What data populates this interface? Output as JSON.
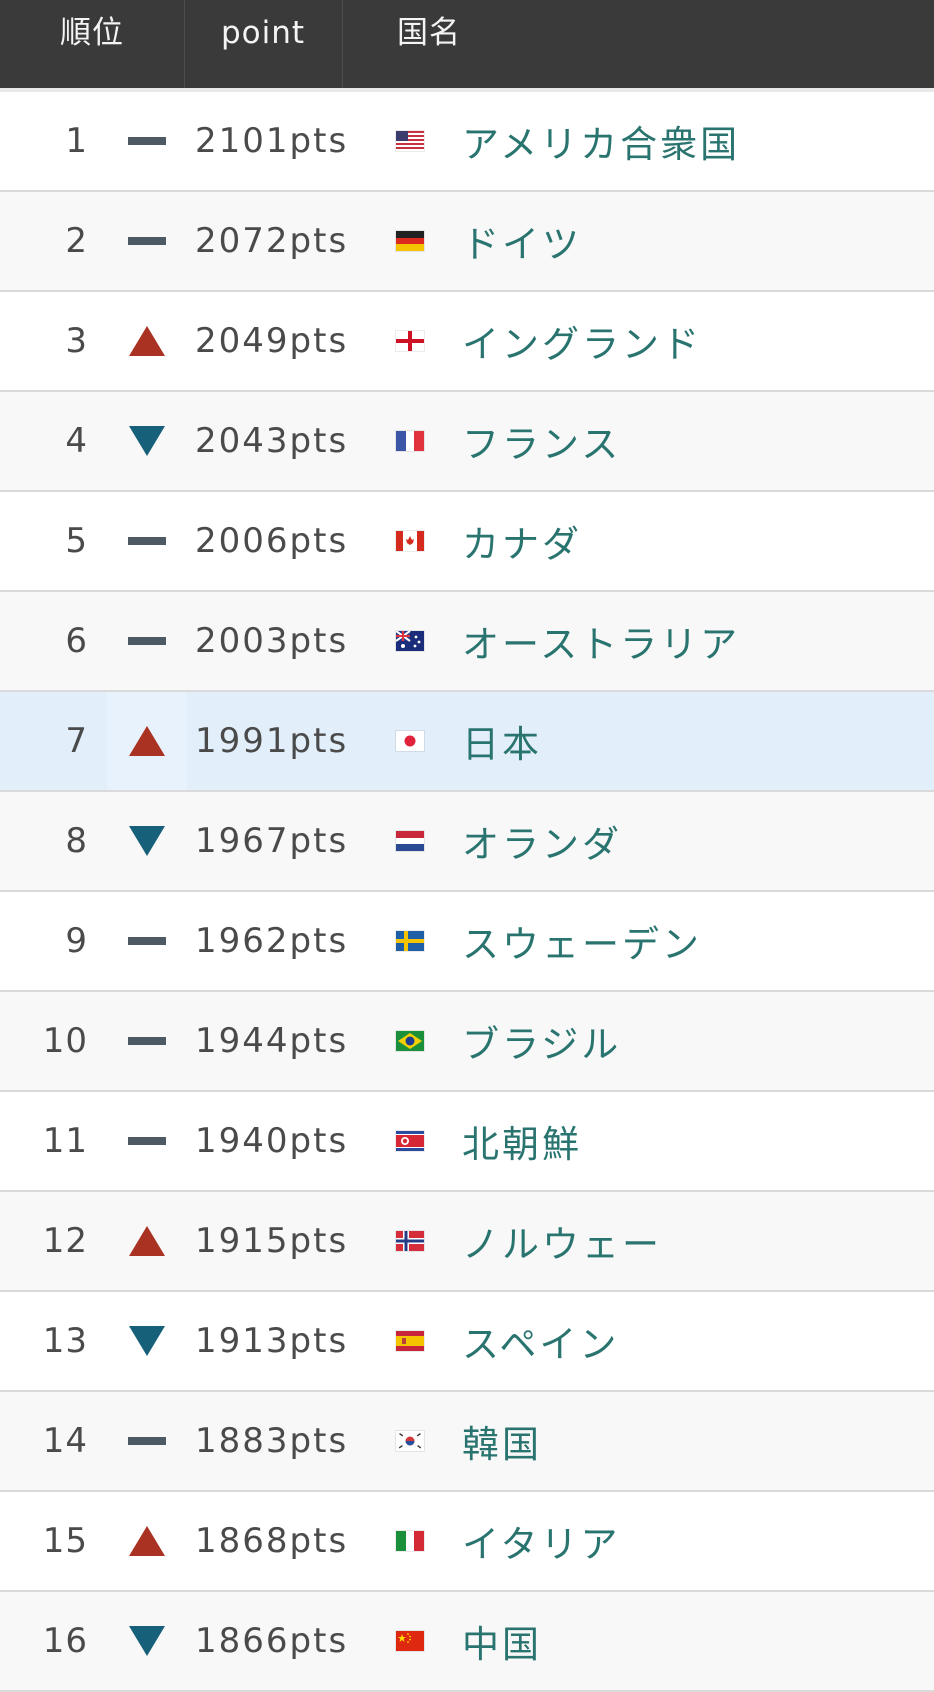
{
  "header": {
    "rank_label": "順位",
    "point_label": "point",
    "country_label": "国名"
  },
  "colors": {
    "header_bg": "#3a3a3a",
    "name_color": "#2a7470",
    "up": "#a93222",
    "down": "#16607a",
    "flat": "#4d5a63",
    "highlight": "#e2effb"
  },
  "rows": [
    {
      "rank": "1",
      "trend": "flat",
      "points": "2101pts",
      "flag": "us-flag-icon",
      "name": "アメリカ合衆国"
    },
    {
      "rank": "2",
      "trend": "flat",
      "points": "2072pts",
      "flag": "de-flag-icon",
      "name": "ドイツ"
    },
    {
      "rank": "3",
      "trend": "up",
      "points": "2049pts",
      "flag": "gb-eng-flag-icon",
      "name": "イングランド"
    },
    {
      "rank": "4",
      "trend": "down",
      "points": "2043pts",
      "flag": "fr-flag-icon",
      "name": "フランス"
    },
    {
      "rank": "5",
      "trend": "flat",
      "points": "2006pts",
      "flag": "ca-flag-icon",
      "name": "カナダ"
    },
    {
      "rank": "6",
      "trend": "flat",
      "points": "2003pts",
      "flag": "au-flag-icon",
      "name": "オーストラリア"
    },
    {
      "rank": "7",
      "trend": "up",
      "points": "1991pts",
      "flag": "jp-flag-icon",
      "name": "日本",
      "highlight": true
    },
    {
      "rank": "8",
      "trend": "down",
      "points": "1967pts",
      "flag": "nl-flag-icon",
      "name": "オランダ"
    },
    {
      "rank": "9",
      "trend": "flat",
      "points": "1962pts",
      "flag": "se-flag-icon",
      "name": "スウェーデン"
    },
    {
      "rank": "10",
      "trend": "flat",
      "points": "1944pts",
      "flag": "br-flag-icon",
      "name": "ブラジル"
    },
    {
      "rank": "11",
      "trend": "flat",
      "points": "1940pts",
      "flag": "kp-flag-icon",
      "name": "北朝鮮"
    },
    {
      "rank": "12",
      "trend": "up",
      "points": "1915pts",
      "flag": "no-flag-icon",
      "name": "ノルウェー"
    },
    {
      "rank": "13",
      "trend": "down",
      "points": "1913pts",
      "flag": "es-flag-icon",
      "name": "スペイン"
    },
    {
      "rank": "14",
      "trend": "flat",
      "points": "1883pts",
      "flag": "kr-flag-icon",
      "name": "韓国"
    },
    {
      "rank": "15",
      "trend": "up",
      "points": "1868pts",
      "flag": "it-flag-icon",
      "name": "イタリア"
    },
    {
      "rank": "16",
      "trend": "down",
      "points": "1866pts",
      "flag": "cn-flag-icon",
      "name": "中国"
    }
  ]
}
